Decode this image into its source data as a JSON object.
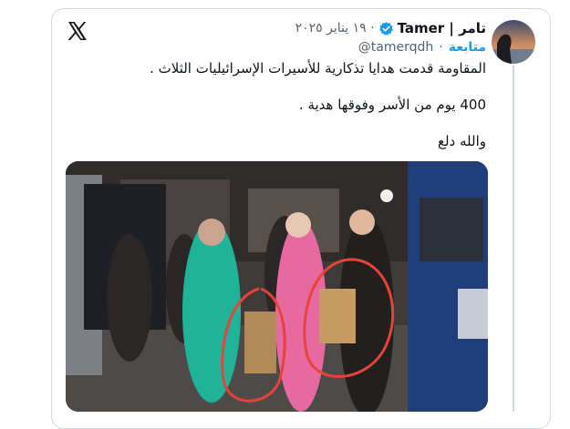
{
  "tweet": {
    "display_name": "تامر | Tamer",
    "handle": "@tamerqdh",
    "date": "١٩ يناير ٢٠٢٥",
    "follow_label": "متابعة",
    "text_lines": [
      "المقاومة قدمت هدايا تذكارية للأسيرات الإسرائيليات الثلاث .",
      "400 يوم من الأسر وفوقها هدية .",
      "والله دلع"
    ]
  },
  "icons": {
    "logo": "x-logo-icon",
    "verified": "verified-badge-icon"
  },
  "colors": {
    "accent": "#1d9bf0",
    "text": "#0f1419",
    "muted": "#536471",
    "annotation_circle": "#e8433a"
  }
}
